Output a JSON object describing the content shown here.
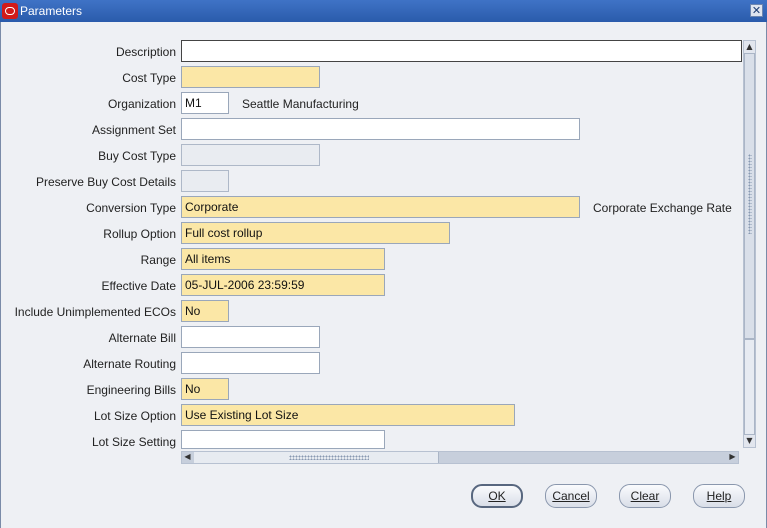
{
  "window": {
    "title": "Parameters",
    "close_glyph": "✕"
  },
  "form": {
    "fields": [
      {
        "label": "Description",
        "value": "",
        "style": "active"
      },
      {
        "label": "Cost Type",
        "value": "",
        "style": "required"
      },
      {
        "label": "Organization",
        "value": "M1",
        "style": "normal",
        "description": "Seattle Manufacturing"
      },
      {
        "label": "Assignment Set",
        "value": "",
        "style": "normal"
      },
      {
        "label": "Buy Cost Type",
        "value": "",
        "style": "readonly"
      },
      {
        "label": "Preserve Buy Cost Details",
        "value": "",
        "style": "readonly"
      },
      {
        "label": "Conversion Type",
        "value": "Corporate",
        "style": "required",
        "description": "Corporate Exchange Rate"
      },
      {
        "label": "Rollup Option",
        "value": "Full cost rollup",
        "style": "required"
      },
      {
        "label": "Range",
        "value": "All items",
        "style": "required"
      },
      {
        "label": "Effective Date",
        "value": "05-JUL-2006 23:59:59",
        "style": "required"
      },
      {
        "label": "Include Unimplemented ECOs",
        "value": "No",
        "style": "required"
      },
      {
        "label": "Alternate Bill",
        "value": "",
        "style": "normal"
      },
      {
        "label": "Alternate Routing",
        "value": "",
        "style": "normal"
      },
      {
        "label": "Engineering Bills",
        "value": "No",
        "style": "required"
      },
      {
        "label": "Lot Size Option",
        "value": "Use Existing Lot Size",
        "style": "required"
      },
      {
        "label": "Lot Size Setting",
        "value": "",
        "style": "normal"
      }
    ]
  },
  "scrollbars": {
    "up_arrow": "▲",
    "down_arrow": "▼",
    "left_arrow": "◀",
    "right_arrow": "▶"
  },
  "buttons": {
    "ok": "OK",
    "cancel": "Cancel",
    "clear": "Clear",
    "help": "Help"
  },
  "colors": {
    "title_bar": "#2f63b5",
    "required_field": "#fbe7a6",
    "readonly_field": "#e9ecf1",
    "background": "#eef0f4"
  },
  "icons": {
    "app": "oracle-logo-icon",
    "close": "close-icon"
  }
}
